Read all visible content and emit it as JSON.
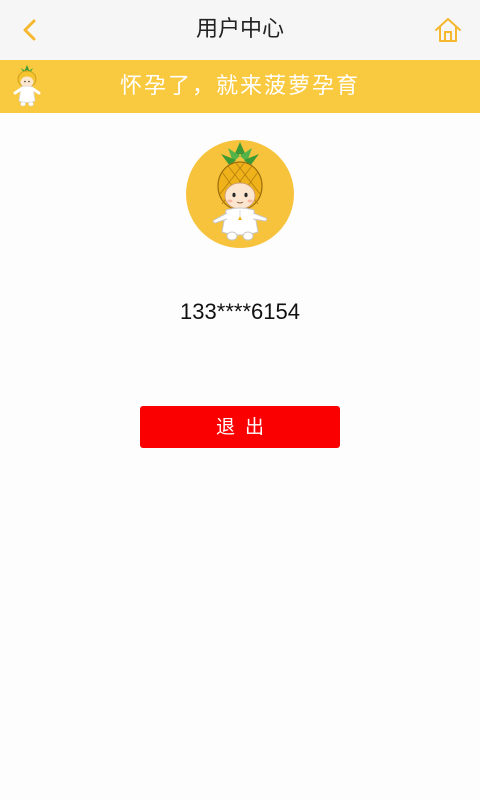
{
  "header": {
    "title": "用户中心",
    "back_icon": "chevron-left-icon",
    "home_icon": "home-icon",
    "accent_color": "#f5b82e"
  },
  "banner": {
    "text": "怀孕了，就来菠萝孕育",
    "background": "#f9c93f",
    "mascot_icon": "pineapple-mascot-icon"
  },
  "profile": {
    "avatar_icon": "pineapple-avatar",
    "phone": "133****6154"
  },
  "actions": {
    "logout_label": "退出",
    "logout_color": "#fb0000"
  }
}
